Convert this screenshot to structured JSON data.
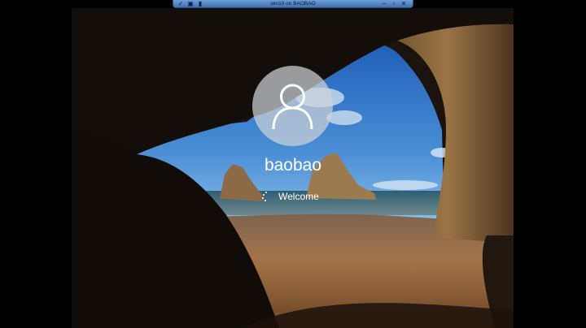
{
  "window": {
    "title": "win10 on BAOBAO"
  },
  "toolbar_icons": [
    "pin-icon",
    "padlock-icon",
    "signal-icon"
  ],
  "window_controls": [
    "minimize-icon",
    "restore-icon",
    "close-icon"
  ],
  "login": {
    "username": "baobao",
    "status": "Welcome"
  },
  "colors": {
    "sky": "#3d7fd0",
    "sea": "#3d6b80",
    "sand": "#9b6b3c",
    "cave": "#1c140e",
    "titlebar": "#5b8fd0"
  }
}
